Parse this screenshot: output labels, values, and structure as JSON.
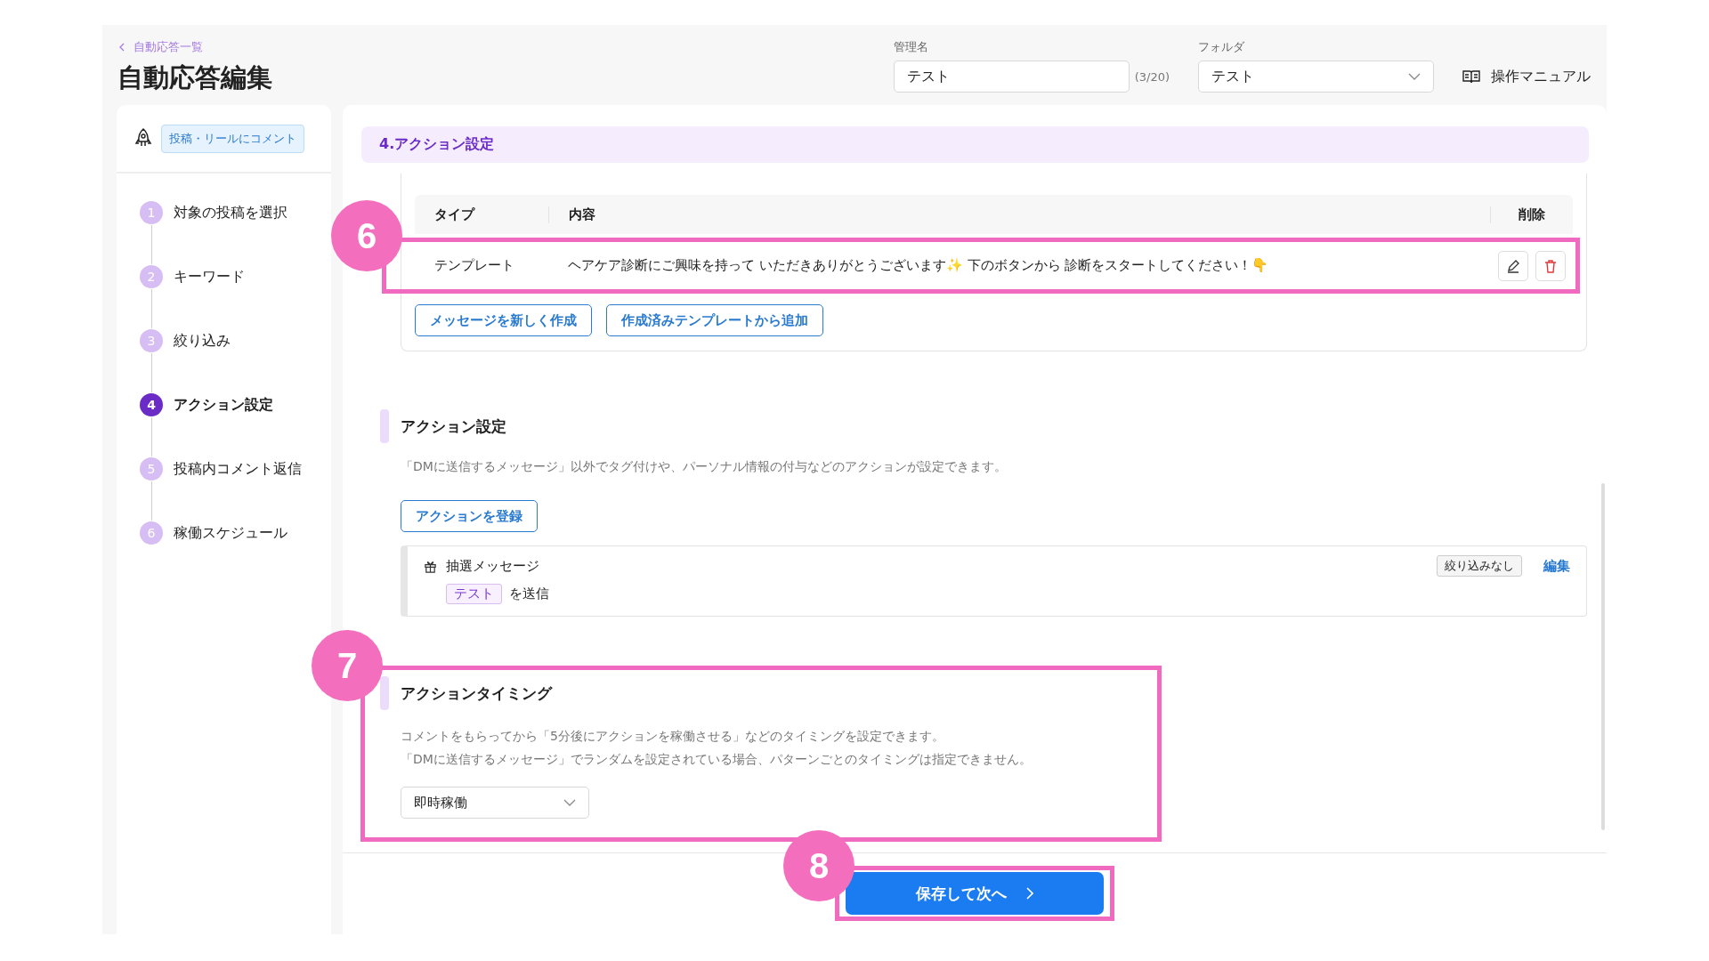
{
  "back_link": {
    "label": "自動応答一覧"
  },
  "page_title": "自動応答編集",
  "name_field": {
    "label": "管理名",
    "value": "テスト",
    "counter": "(3/20)"
  },
  "folder_select": {
    "label": "フォルダ",
    "value": "テスト"
  },
  "manual_link": {
    "label": "操作マニュアル"
  },
  "trigger_tag": "投稿・リールにコメント",
  "steps": [
    {
      "number": "1",
      "label": "対象の投稿を選択",
      "selected": false
    },
    {
      "number": "2",
      "label": "キーワード",
      "selected": false
    },
    {
      "number": "3",
      "label": "絞り込み",
      "selected": false
    },
    {
      "number": "4",
      "label": "アクション設定",
      "selected": true
    },
    {
      "number": "5",
      "label": "投稿内コメント返信",
      "selected": false
    },
    {
      "number": "6",
      "label": "稼働スケジュール",
      "selected": false
    }
  ],
  "section_title": "4.アクション設定",
  "message_table": {
    "columns": [
      "タイプ",
      "内容",
      "削除"
    ],
    "rows": [
      {
        "type": "テンプレート",
        "content": "ヘアケア診断にご興味を持って いただきありがとうございます✨ 下のボタンから 診断をスタートしてください！👇",
        "callout": "6"
      }
    ]
  },
  "message_buttons": [
    "メッセージを新しく作成",
    "作成済みテンプレートから追加"
  ],
  "action_settings": {
    "title": "アクション設定",
    "description": "「DMに送信するメッセージ」以外でタグ付けや、パーソナル情報の付与などのアクションが設定できます。",
    "register_button": "アクションを登録",
    "actions": [
      {
        "name": "抽選メッセージ",
        "filter": "絞り込みなし",
        "edit": "編集",
        "tag": "テスト",
        "suffix": "を送信"
      }
    ]
  },
  "action_timing": {
    "title": "アクションタイミング",
    "description_lines": [
      "コメントをもらってから「5分後にアクションを稼働させる」などのタイミングを設定できます。",
      "「DMに送信するメッセージ」でランダムを設定されている場合、パターンごとのタイミングは指定できません。"
    ],
    "select_value": "即時稼働",
    "callout": "7"
  },
  "save_button": {
    "label": "保存して次へ",
    "callout": "8"
  }
}
